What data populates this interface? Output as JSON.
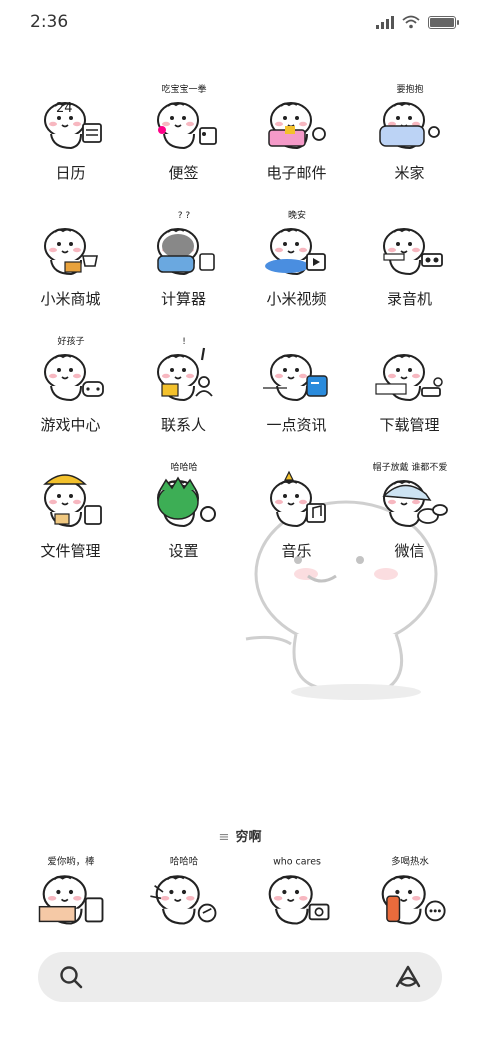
{
  "status_bar": {
    "time": "2:36",
    "battery_level": 1.0
  },
  "apps": [
    {
      "label": "日历",
      "icon": "calendar-mascot-icon",
      "caption": "24"
    },
    {
      "label": "便签",
      "icon": "notes-mascot-icon",
      "caption": "吃宝宝一拳"
    },
    {
      "label": "电子邮件",
      "icon": "email-mascot-icon",
      "caption": ""
    },
    {
      "label": "米家",
      "icon": "mijia-mascot-icon",
      "caption": "要抱抱"
    },
    {
      "label": "小米商城",
      "icon": "store-mascot-icon",
      "caption": ""
    },
    {
      "label": "计算器",
      "icon": "calculator-mascot-icon",
      "caption": "? ?"
    },
    {
      "label": "小米视频",
      "icon": "video-mascot-icon",
      "caption": "晚安"
    },
    {
      "label": "录音机",
      "icon": "recorder-mascot-icon",
      "caption": ""
    },
    {
      "label": "游戏中心",
      "icon": "game-mascot-icon",
      "caption": "好孩子"
    },
    {
      "label": "联系人",
      "icon": "contacts-mascot-icon",
      "caption": "!"
    },
    {
      "label": "一点资讯",
      "icon": "news-mascot-icon",
      "caption": ""
    },
    {
      "label": "下载管理",
      "icon": "download-mascot-icon",
      "caption": ""
    },
    {
      "label": "文件管理",
      "icon": "files-mascot-icon",
      "caption": ""
    },
    {
      "label": "设置",
      "icon": "settings-mascot-icon",
      "caption": "哈哈哈"
    },
    {
      "label": "音乐",
      "icon": "music-mascot-icon",
      "caption": ""
    },
    {
      "label": "微信",
      "icon": "wechat-mascot-icon",
      "caption": "帽子放戴 谁都不爱"
    }
  ],
  "dock_hint": "穷啊",
  "dock": [
    {
      "icon": "bank-mascot-icon",
      "caption": "爱你哟，棒"
    },
    {
      "icon": "camera-laugh-mascot-icon",
      "caption": "哈哈哈"
    },
    {
      "icon": "camera-mascot-icon",
      "caption": "who cares"
    },
    {
      "icon": "messages-mascot-icon",
      "caption": "多喝热水"
    }
  ],
  "colors": {
    "background": "#ffffff",
    "search_bar": "#ececec",
    "pink_cheek": "#f7b7c0",
    "accent_blue": "#2a8bdc",
    "accent_green": "#3dae55",
    "accent_yellow": "#f3c12c"
  }
}
